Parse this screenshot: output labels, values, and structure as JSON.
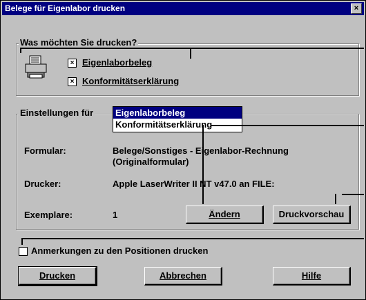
{
  "window": {
    "title": "Belege für Eigenlabor drucken",
    "close_glyph": "×"
  },
  "what_group": {
    "label": "Was möchten Sie drucken?",
    "icon": "printer-icon",
    "options": [
      {
        "label": "Eigenlaborbeleg",
        "checked": true,
        "mark": "×"
      },
      {
        "label": "Konformitätserklärung",
        "checked": true,
        "mark": "×"
      }
    ]
  },
  "settings_group": {
    "label": "Einstellungen für",
    "list_options": [
      "Eigenlaborbeleg",
      "Konformitätserklärung"
    ],
    "selected": "Eigenlaborbeleg",
    "formular_label": "Formular:",
    "formular_value_line1": "Belege/Sonstiges - Eigenlabor-Rechnung",
    "formular_value_line2": "(Originalformular)",
    "drucker_label": "Drucker:",
    "drucker_value": "Apple LaserWriter II NT v47.0 an FILE:",
    "exemplare_label": "Exemplare:",
    "exemplare_value": "1",
    "aendern_button": "Ändern",
    "druckvorschau_button": "Druckvorschau"
  },
  "anmerkungen": {
    "label": "Anmerkungen zu den Positionen drucken",
    "checked": false
  },
  "buttons": {
    "drucken": "Drucken",
    "abbrechen": "Abbrechen",
    "hilfe": "Hilfe"
  }
}
